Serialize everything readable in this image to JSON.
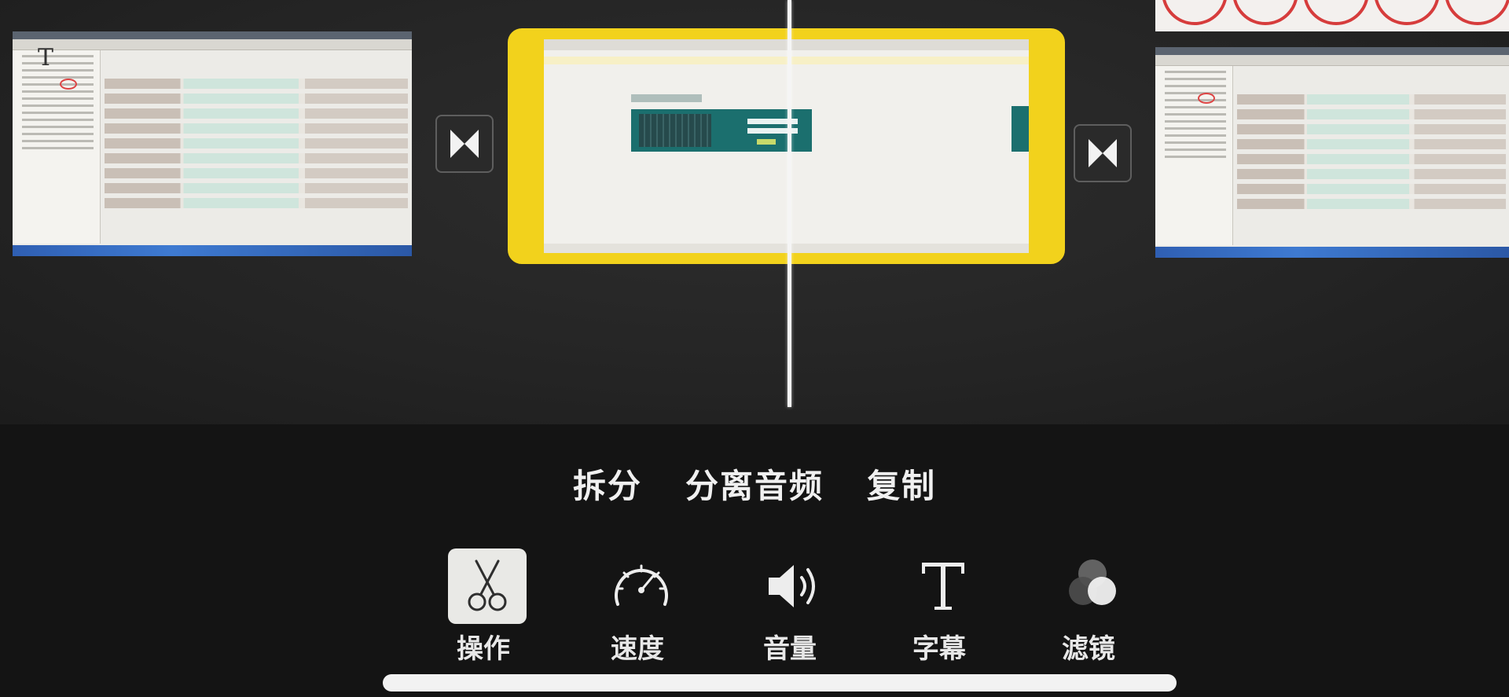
{
  "actions": {
    "split": "拆分",
    "detach_audio": "分离音频",
    "duplicate": "复制"
  },
  "tools": [
    {
      "label": "操作",
      "icon": "scissors-icon",
      "active": true
    },
    {
      "label": "速度",
      "icon": "speedometer-icon",
      "active": false
    },
    {
      "label": "音量",
      "icon": "speaker-icon",
      "active": false
    },
    {
      "label": "字幕",
      "icon": "title-t-icon",
      "active": false
    },
    {
      "label": "滤镜",
      "icon": "filter-circles-icon",
      "active": false
    }
  ],
  "colors": {
    "selection": "#f2d21c",
    "background": "#141414",
    "timeline_bg": "#242424",
    "text": "#f0f0f0"
  }
}
